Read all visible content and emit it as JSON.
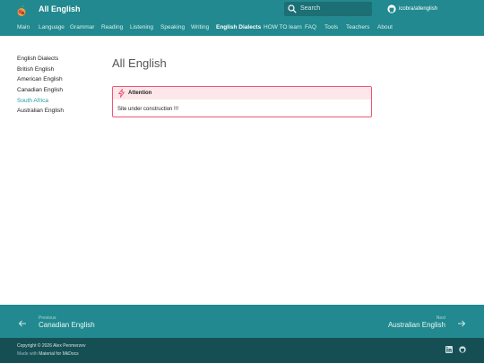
{
  "header": {
    "site_title": "All English",
    "search_placeholder": "Search",
    "repo": "icobra/allenglish"
  },
  "tabs": [
    {
      "label": "Main",
      "active": false
    },
    {
      "label": "Language",
      "active": false
    },
    {
      "label": "Grammar",
      "active": false
    },
    {
      "label": "Reading",
      "active": false
    },
    {
      "label": "Listening",
      "active": false
    },
    {
      "label": "Speaking",
      "active": false
    },
    {
      "label": "Writing",
      "active": false
    },
    {
      "label": "English Dialects",
      "active": true
    },
    {
      "label": "HOW TO learn",
      "active": false
    },
    {
      "label": "FAQ",
      "active": false
    },
    {
      "label": "Tools",
      "active": false
    },
    {
      "label": "Teachers",
      "active": false
    },
    {
      "label": "About",
      "active": false
    }
  ],
  "sidebar": {
    "items": [
      {
        "label": "English Dialects",
        "active": false
      },
      {
        "label": "British English",
        "active": false
      },
      {
        "label": "American English",
        "active": false
      },
      {
        "label": "Canadian English",
        "active": false
      },
      {
        "label": "South Africa",
        "active": true
      },
      {
        "label": "Australian English",
        "active": false
      }
    ]
  },
  "main": {
    "title": "All English",
    "admonition": {
      "label": "Attention",
      "text": "Site under construction !!!"
    }
  },
  "footer_nav": {
    "previous_label": "Previous",
    "previous_title": "Canadian English",
    "next_label": "Next",
    "next_title": "Australian English"
  },
  "footer": {
    "copyright": "Copyright © 2026 Alex Penmerzev",
    "made_with_prefix": "Made with",
    "made_with_link": "Material for MkDocs"
  },
  "colors": {
    "primary": "#21898f",
    "footer_dark": "#164f53",
    "accent": "#1f9aa3",
    "admonition_border": "#f05672",
    "admonition_bg": "#fde7eb"
  },
  "icons": {
    "logo": "apple-logo-icon",
    "search": "search-icon",
    "repo": "github-icon",
    "admonition": "lightning-bolt-icon",
    "prev": "arrow-left-icon",
    "next": "arrow-right-icon",
    "social": [
      "linkedin-icon",
      "github-icon"
    ]
  }
}
